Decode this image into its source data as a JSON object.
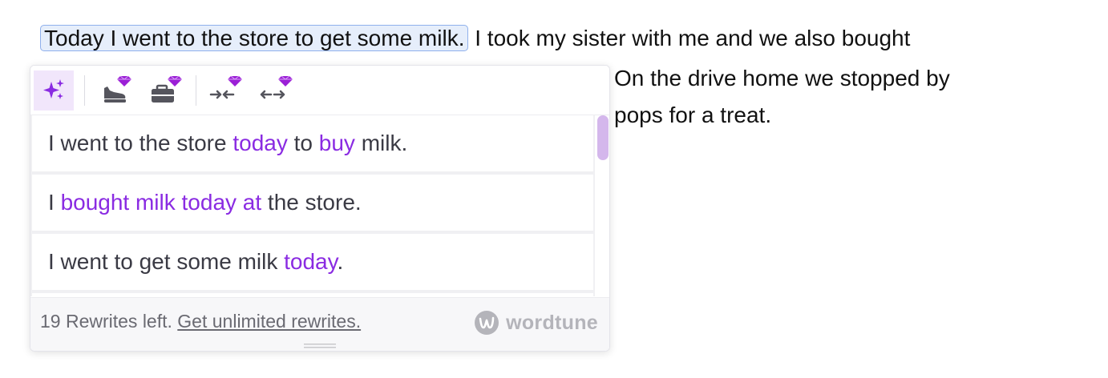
{
  "document": {
    "line1_selected": "Today I went to the store to get some milk.",
    "line1_rest": "I took my sister with me and we also bought",
    "line2": "On the drive home we stopped by",
    "line3": "pops for a treat."
  },
  "toolbar": {
    "tools": [
      {
        "name": "rewrite-sparkle-icon",
        "premium": false,
        "active": true
      },
      {
        "name": "casual-shoe-icon",
        "premium": true
      },
      {
        "name": "formal-briefcase-icon",
        "premium": true
      },
      {
        "name": "shorten-icon",
        "premium": true
      },
      {
        "name": "expand-icon",
        "premium": true
      }
    ]
  },
  "suggestions": [
    {
      "parts": [
        {
          "text": "I went to the store ",
          "hl": false
        },
        {
          "text": "today",
          "hl": true
        },
        {
          "text": " to ",
          "hl": false
        },
        {
          "text": "buy",
          "hl": true
        },
        {
          "text": " milk.",
          "hl": false
        }
      ]
    },
    {
      "parts": [
        {
          "text": "I ",
          "hl": false
        },
        {
          "text": "bought milk today at",
          "hl": true
        },
        {
          "text": " the store.",
          "hl": false
        }
      ]
    },
    {
      "parts": [
        {
          "text": "I went to get some milk ",
          "hl": false
        },
        {
          "text": "today",
          "hl": true
        },
        {
          "text": ".",
          "hl": false
        }
      ]
    }
  ],
  "footer": {
    "rewrites_left": "19 Rewrites left.",
    "upgrade_link": "Get unlimited rewrites.",
    "brand": "wordtune"
  },
  "colors": {
    "accent": "#8a2be2",
    "selection_bg": "#e6eefb",
    "scroll_thumb": "#d4b7ec",
    "gem": "#9b1fd6"
  }
}
